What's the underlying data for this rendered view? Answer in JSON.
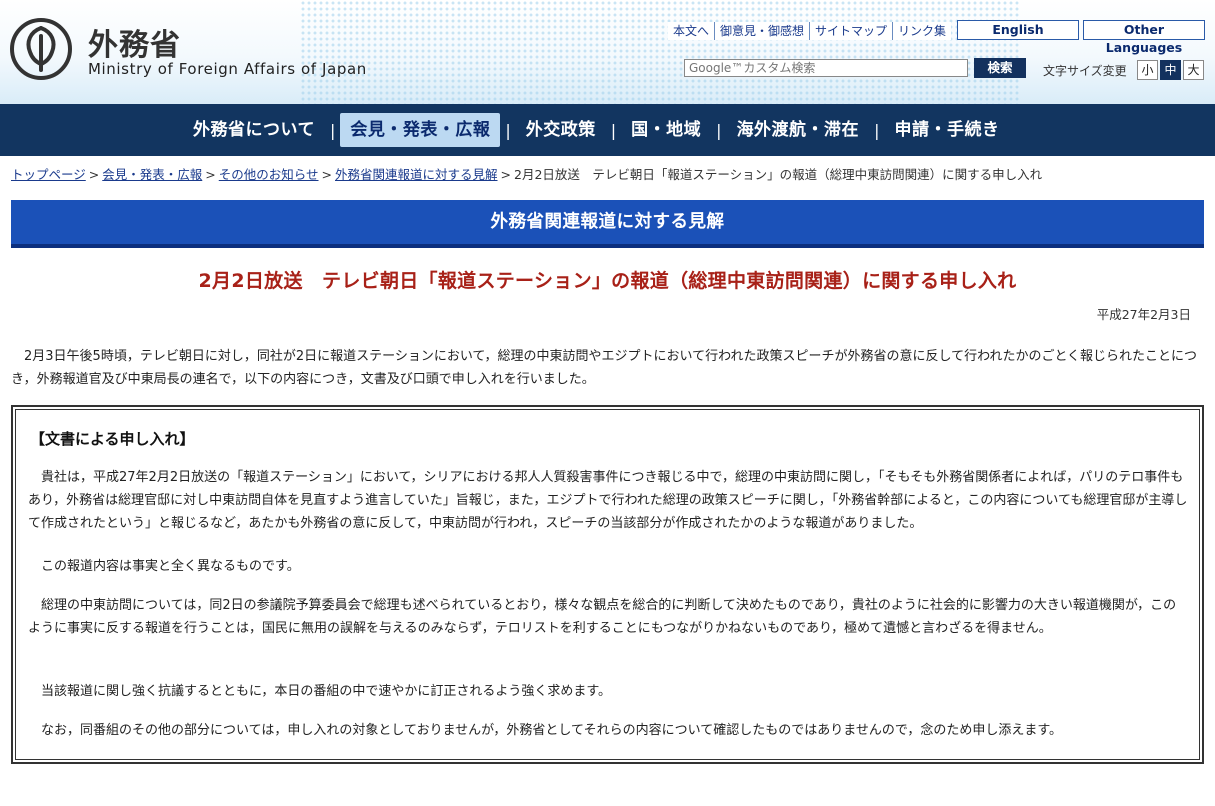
{
  "header": {
    "logo_jp": "外務省",
    "logo_en": "Ministry of Foreign Affairs of Japan",
    "util_links": [
      "本文へ",
      "御意見・御感想",
      "サイトマップ",
      "リンク集"
    ],
    "english": "English",
    "other_languages": "Other Languages",
    "search_placeholder": "Google™カスタム検索",
    "search_button": "検索",
    "font_size_label": "文字サイズ変更",
    "font_sizes": [
      "小",
      "中",
      "大"
    ]
  },
  "nav": {
    "items": [
      "外務省について",
      "会見・発表・広報",
      "外交政策",
      "国・地域",
      "海外渡航・滞在",
      "申請・手続き"
    ],
    "active_index": 1
  },
  "breadcrumb": {
    "links": [
      "トップページ",
      "会見・発表・広報",
      "その他のお知らせ",
      "外務省関連報道に対する見解"
    ],
    "current": "2月2日放送　テレビ朝日「報道ステーション」の報道（総理中東訪問関連）に関する申し入れ"
  },
  "banner": "外務省関連報道に対する見解",
  "title": "2月2日放送　テレビ朝日「報道ステーション」の報道（総理中東訪問関連）に関する申し入れ",
  "date": "平成27年2月3日",
  "intro": "　2月3日午後5時頃，テレビ朝日に対し，同社が2日に報道ステーションにおいて，総理の中東訪問やエジプトにおいて行われた政策スピーチが外務省の意に反して行われたかのごとく報じられたことにつき，外務報道官及び中東局長の連名で，以下の内容につき，文書及び口頭で申し入れを行いました。",
  "letter": {
    "heading": "【文書による申し入れ】",
    "paragraphs": [
      "　貴社は，平成27年2月2日放送の「報道ステーション」において，シリアにおける邦人人質殺害事件につき報じる中で，総理の中東訪問に関し，「そもそも外務省関係者によれば，パリのテロ事件もあり，外務省は総理官邸に対し中東訪問自体を見直すよう進言していた」旨報じ，また，エジプトで行われた総理の政策スピーチに関し，「外務省幹部によると，この内容についても総理官邸が主導して作成されたという」と報じるなど，あたかも外務省の意に反して，中東訪問が行われ，スピーチの当該部分が作成されたかのような報道がありました。",
      "　この報道内容は事実と全く異なるものです。",
      "　総理の中東訪問については，同2日の参議院予算委員会で総理も述べられているとおり，様々な観点を総合的に判断して決めたものであり，貴社のように社会的に影響力の大きい報道機関が，このように事実に反する報道を行うことは，国民に無用の誤解を与えるのみならず，テロリストを利することにもつながりかねないものであり，極めて遺憾と言わざるを得ません。",
      "　当該報道に関し強く抗議するとともに，本日の番組の中で速やかに訂正されるよう強く求めます。",
      "　なお，同番組のその他の部分については，申し入れの対象としておりませんが，外務省としてそれらの内容について確認したものではありませんので，念のため申し添えます。"
    ]
  }
}
